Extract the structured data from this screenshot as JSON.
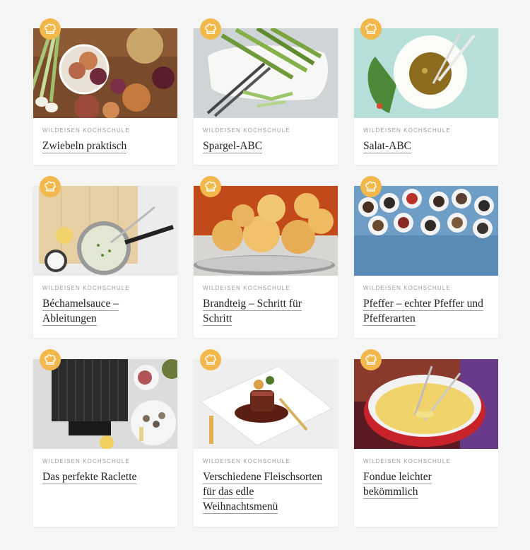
{
  "kicker": "WILDEISEN KOCHSCHULE",
  "badge_icon": "chef-hat-icon",
  "accent": "#f2b84b",
  "cards": [
    {
      "title": "Zwiebeln praktisch",
      "image": "onions"
    },
    {
      "title": "Spargel-ABC",
      "image": "asparagus"
    },
    {
      "title": "Salat-ABC",
      "image": "salad-dressing"
    },
    {
      "title": "Béchamelsauce – Ableitungen",
      "image": "bechamel-pot"
    },
    {
      "title": "Brandteig – Schritt für Schritt",
      "image": "choux-puffs"
    },
    {
      "title": "Pfeffer – echter Pfeffer und Pfefferarten",
      "image": "pepper-bowls"
    },
    {
      "title": "Das perfekte Raclette",
      "image": "raclette-grill"
    },
    {
      "title": "Verschiedene Fleischsorten für das edle Weihnachtsmenü",
      "image": "steak-plate"
    },
    {
      "title": "Fondue leichter bekömmlich",
      "image": "fondue-pot"
    }
  ]
}
